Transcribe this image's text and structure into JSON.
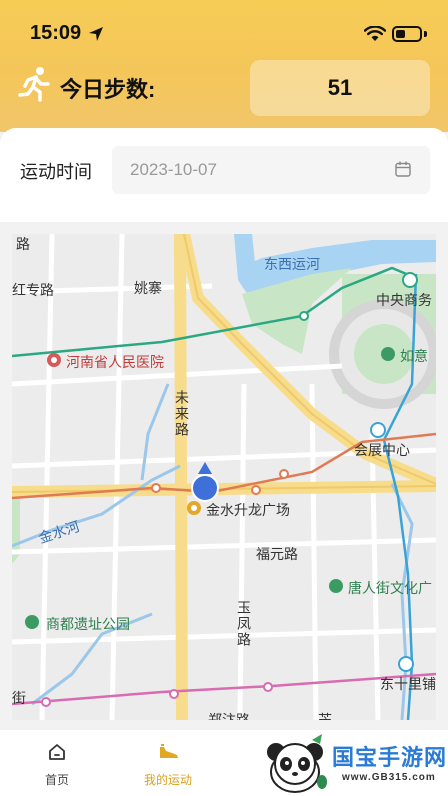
{
  "status_bar": {
    "time": "15:09"
  },
  "steps": {
    "label": "今日步数:",
    "value": "51"
  },
  "date_filter": {
    "label": "运动时间",
    "value": "2023-10-07"
  },
  "map": {
    "labels": {
      "road_top_left": "路",
      "hongzhuan": "红专路",
      "yaozhai": "姚寨",
      "dongxi_canal": "东西运河",
      "cbd": "中央商务",
      "henan_hospital": "河南省人民医院",
      "ruyi": "如意",
      "weilai": "未来路",
      "expo": "会展中心",
      "jinshui_river": "金水河",
      "jinshui_plaza": "金水升龙广场",
      "fuyuan": "福元路",
      "tangren": "唐人街文化广",
      "yufeng": "玉凤路",
      "shangdu_park": "商都遗址公园",
      "dongshili": "东十里铺",
      "jie": "街",
      "zhengbian": "郑汴路",
      "bottom_char": "芒"
    }
  },
  "nav": {
    "home_label": "首页",
    "sport_label": "我的运动"
  },
  "watermark": {
    "text": "国宝手游网",
    "url": "www.GB315.com"
  }
}
